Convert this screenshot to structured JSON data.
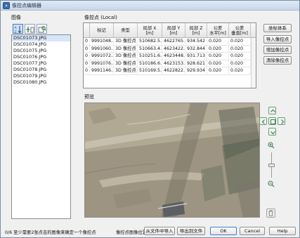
{
  "window": {
    "title": "像控点编辑器"
  },
  "images_panel": {
    "label": "图像",
    "items": [
      "DSC01073.JPG",
      "DSC01074.JPG",
      "DSC01075.JPG",
      "DSC01076.JPG",
      "DSC01077.JPG",
      "DSC01078.JPG",
      "DSC01079.JPG",
      "DSC01080.JPG"
    ],
    "selected_index": 0
  },
  "gcp_panel": {
    "label": "像控点 (Local)",
    "columns": [
      "",
      "标记",
      "类型",
      "局部 X\n[m]",
      "局部 Y\n[m]",
      "局部 Z\n[m]",
      "公差\n水平[m]",
      "公差\n垂直[m]"
    ],
    "rows": [
      [
        "0",
        "9991048...",
        "3D 像控点",
        "510682.5...",
        "4622765...",
        "934.542",
        "0.020",
        "0.020"
      ],
      [
        "0",
        "9991060...",
        "3D 像控点",
        "510663.4...",
        "4623422...",
        "932.844",
        "0.020",
        "0.020"
      ],
      [
        "0",
        "9991072...",
        "3D 像控点",
        "510251.6...",
        "4623448...",
        "931.713",
        "0.020",
        "0.020"
      ],
      [
        "0",
        "9991076...",
        "3D 像控点",
        "510186.6...",
        "4623153...",
        "928.621",
        "0.020",
        "0.020"
      ],
      [
        "0",
        "9991146...",
        "3D 像控点",
        "510169.5...",
        "4622822...",
        "929.934",
        "0.020",
        "0.020"
      ]
    ]
  },
  "side_buttons": {
    "coord_system": "坐标体系",
    "import": "导入像控点",
    "add": "增加像控点",
    "clear": "清除像控点"
  },
  "preview": {
    "label": "预览"
  },
  "footer": {
    "status": "0/6  至少需要2张点击的图像来确定一个像控点",
    "location_label": "像控点图像位置:",
    "import_from_file": "从文件中导入",
    "export_to_file": "导出到文件",
    "ok": "OK",
    "cancel": "Cancel",
    "help": "Help"
  },
  "colors": {
    "accent": "#3c7fd1",
    "nav_green": "#4f8f5f"
  }
}
